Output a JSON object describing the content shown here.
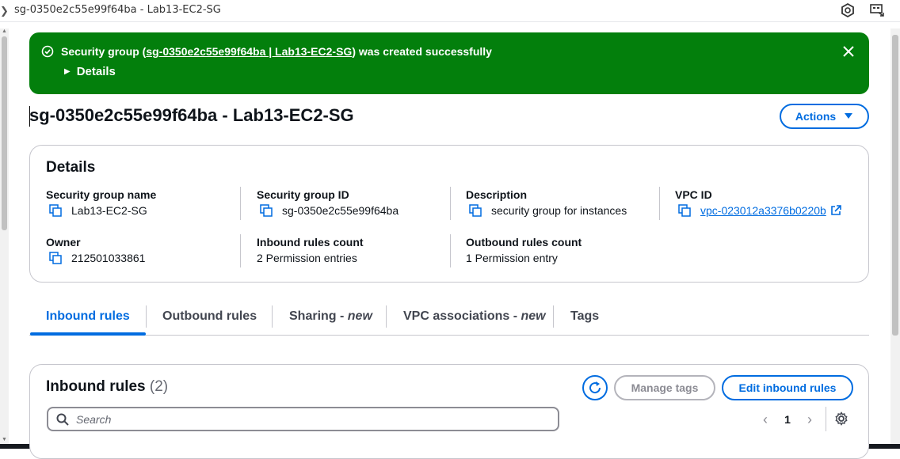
{
  "window": {
    "title": "sg-0350e2c55e99f64ba - Lab13-EC2-SG"
  },
  "flash": {
    "message_prefix": "Security group (",
    "message_link": "sg-0350e2c55e99f64ba | Lab13-EC2-SG",
    "message_suffix": ") was created successfully",
    "details_label": "Details",
    "color": "#037f0c"
  },
  "page": {
    "title": "sg-0350e2c55e99f64ba - Lab13-EC2-SG",
    "actions_label": "Actions"
  },
  "details": {
    "heading": "Details",
    "fields": [
      {
        "label": "Security group name",
        "value": "Lab13-EC2-SG"
      },
      {
        "label": "Security group ID",
        "value": "sg-0350e2c55e99f64ba"
      },
      {
        "label": "Description",
        "value": "security group for instances"
      },
      {
        "label": "VPC ID",
        "value": "vpc-023012a3376b0220b"
      },
      {
        "label": "Owner",
        "value": "212501033861"
      },
      {
        "label": "Inbound rules count",
        "value": "2 Permission entries"
      },
      {
        "label": "Outbound rules count",
        "value": "1 Permission entry"
      }
    ]
  },
  "tabs": [
    {
      "label": "Inbound rules",
      "suffix": "",
      "active": true
    },
    {
      "label": "Outbound rules",
      "suffix": ""
    },
    {
      "label": "Sharing - ",
      "suffix": "new"
    },
    {
      "label": "VPC associations - ",
      "suffix": "new"
    },
    {
      "label": "Tags",
      "suffix": ""
    }
  ],
  "inbound": {
    "heading": "Inbound rules",
    "count": "(2)",
    "manage_tags_label": "Manage tags",
    "edit_label": "Edit inbound rules",
    "search_placeholder": "Search",
    "page_number": "1"
  },
  "colors": {
    "accent": "#006ce0",
    "success": "#037f0c"
  }
}
